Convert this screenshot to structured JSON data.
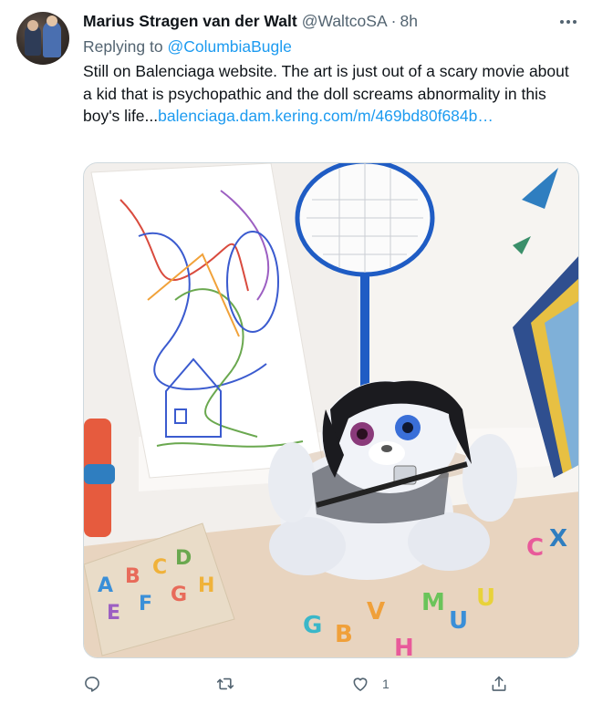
{
  "tweet": {
    "author_name": "Marius Stragen van der Walt",
    "handle": "@WaltcoSA",
    "separator": "·",
    "time": "8h",
    "replying_prefix": "Replying to",
    "replying_to": "@ColumbiaBugle",
    "text": "Still on Balenciaga website. The art is just out of a scary movie about a kid that is psychopathic and the doll screams abnormality in this boy's life...",
    "link": "balenciaga.dam.kering.com/m/469bd80f684b…",
    "media_alt": "Photo",
    "actions": {
      "reply_count": "",
      "retweet_count": "",
      "like_count": "1"
    }
  },
  "icons": [
    "avatar",
    "more-icon",
    "reply-icon",
    "retweet-icon",
    "like-icon",
    "share-icon"
  ],
  "colors": {
    "link": "#1d9bf0",
    "secondary_text": "#536471",
    "primary_text": "#0f1419",
    "border": "#cfd9de"
  }
}
